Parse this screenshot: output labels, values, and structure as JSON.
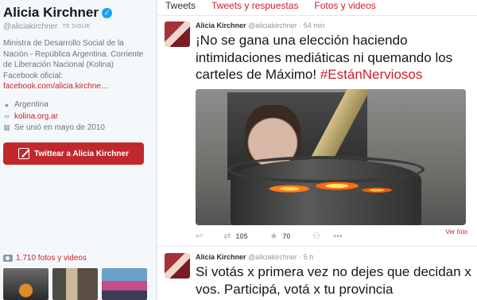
{
  "profile": {
    "name": "Alicia Kirchner",
    "handle": "@aliciakirchner",
    "follows_badge": "TE SIGUE",
    "bio_line1": "Ministra de Desarrollo Social de la",
    "bio_line2": "Nación - República Argentina.  Corriente",
    "bio_line3": "de Liberación Nacional (Kolina)",
    "bio_line4": "Facebook oficial:",
    "bio_link": "facebook.com/alicia.kirchne…",
    "location": "Argentina",
    "website": "kolina.org.ar",
    "joined": "Se unió en mayo de 2010",
    "tweet_button": "Twittear a Alicia Kirchner",
    "photos_link": "1.710 fotos y videos"
  },
  "tabs": [
    "Tweets",
    "Tweets y respuestas",
    "Fotos y videos"
  ],
  "tweets": [
    {
      "author": "Alicia Kirchner",
      "handle": "@aliciakirchner",
      "time": "54 min",
      "text": "¡No se gana una elección haciendo intimidaciones mediáticas ni quemando los carteles de Máximo! ",
      "hashtag": "#EstánNerviosos",
      "retweets": "105",
      "favorites": "70",
      "view_photo": "Ver foto"
    },
    {
      "author": "Alicia Kirchner",
      "handle": "@aliciakirchner",
      "time": "5 h",
      "text": "Si votás x primera vez no dejes que decidan x vos. Participá, votá x tu provincia"
    }
  ],
  "colors": {
    "accent": "#cc1e2a",
    "button": "#c0282e",
    "verified": "#1da1f2"
  },
  "icons": [
    "verified-badge-icon",
    "location-pin-icon",
    "link-icon",
    "calendar-icon",
    "quill-icon",
    "camera-icon",
    "reply-icon",
    "retweet-icon",
    "star-icon",
    "follow-icon",
    "more-icon"
  ]
}
